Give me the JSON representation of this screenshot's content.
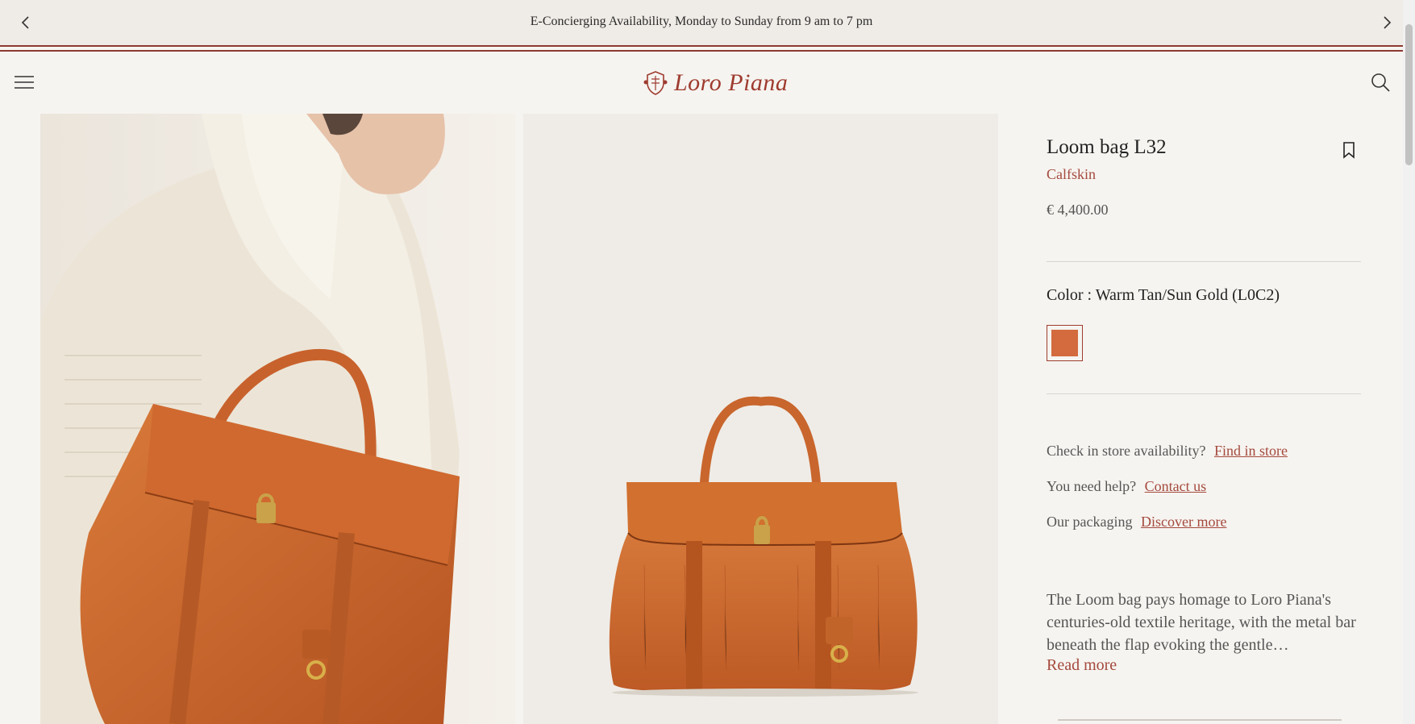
{
  "announcement": {
    "message": "E-Concierging Availability, Monday to Sunday from 9 am to 7 pm",
    "prev_icon": "chevron-left-icon",
    "next_icon": "chevron-right-icon"
  },
  "header": {
    "logo_text": "Loro Piana",
    "menu_icon": "hamburger-icon",
    "search_icon": "search-icon"
  },
  "gallery": {
    "images": [
      "model-carrying-bag",
      "bag-front-view"
    ]
  },
  "product": {
    "title": "Loom bag L32",
    "material": "Calfskin",
    "price": "€ 4,400.00",
    "color_label": "Color : Warm Tan/Sun Gold (L0C2)",
    "swatch_color": "#d36b3e",
    "store_prompt": "Check in store availability?",
    "store_link": "Find in store",
    "help_prompt": "You need help?",
    "help_link": "Contact us",
    "packaging_prompt": "Our packaging",
    "packaging_link": "Discover more",
    "description": "The Loom bag pays homage to Loro Piana's centuries-old textile heritage, with the metal bar beneath the flap evoking the gentle…",
    "read_more": "Read more"
  },
  "colors": {
    "accent": "#9e3b2f",
    "background": "#f6f4f0",
    "leather": "#c8622d"
  }
}
